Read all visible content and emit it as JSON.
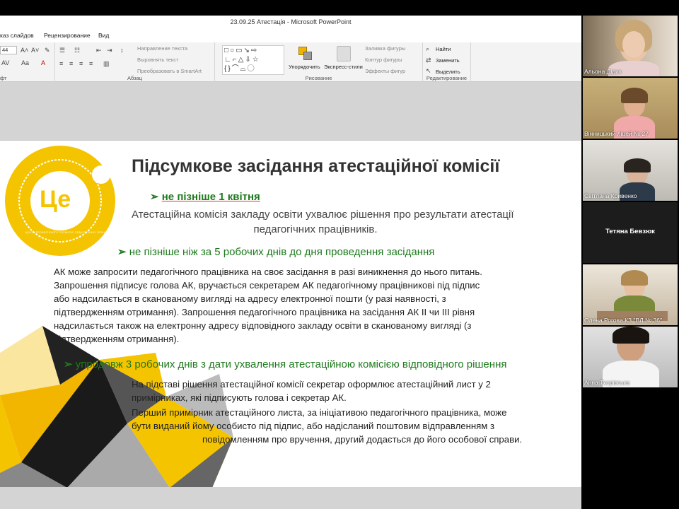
{
  "window": {
    "title": "23.09.25 Атестація  -  Microsoft PowerPoint"
  },
  "ribbon": {
    "tabs": [
      "каз слайдов",
      "Рецензирование",
      "Вид"
    ],
    "font_size": "44",
    "font_size_label_partial": "фт",
    "paragraph_group": "Абзац",
    "text_direction": "Направление текста",
    "align_text": "Выровнять текст",
    "smartart": "Преобразовать в SmartArt",
    "drawing_group": "Рисование",
    "arrange": "Упорядочить",
    "quick_styles": "Экспресс-стили",
    "shape_fill": "Заливка фигуры",
    "shape_outline": "Контур фигуры",
    "shape_effects": "Эффекты фигур",
    "find": "Найти",
    "replace": "Заменить",
    "select": "Выделить",
    "editing_group": "Редактирование"
  },
  "slide": {
    "logo_text": "Це",
    "logo_ring_text": "ЦЕНТР ПРОФЕСІЙНОГО РОЗВИТКУ ПЕДАГОГІЧНИХ ПРАЦІВНИКІВ ВМР",
    "title": "Підсумкове засідання атестаційної комісії",
    "bullet1": "не пізніше  1 квітня",
    "decision_line1": "Атестаційна комісія закладу освіти ухвалює рішення про результати атестації",
    "decision_line2": "педагогічних працівників.",
    "bullet2": "не пізніше  ніж за 5 робочих днів до дня проведення засідання",
    "para1": [
      "АК може запросити педагогічного працівника на своє засідання в разі виникнення до нього питань.",
      "Запрошення підписує голова АК, вручається секретарем АК педагогічному працівникові під підпис",
      "або надсилається в сканованому вигляді на адресу електронної пошти (у разі наявності, з",
      "підтвердженням отримання). Запрошення педагогічного працівника на засідання АК ІІ чи ІІІ рівня",
      "надсилається також на електронну адресу відповідного закладу освіти в сканованому вигляді (з",
      "підтвердженням отримання)."
    ],
    "bullet3": "упродовж 3 робочих днів з дати ухвалення атестаційною комісією відповідного рішення",
    "para2": [
      "На підставі рішення атестаційної  комісії секретар оформлює атестаційний лист у 2",
      "примірниках, які підписують голова і секретар АК.",
      "Перший примірник атестаційного листа, за ініціативою педагогічного працівника, може",
      "бути виданий йому особисто під підпис, або надісланий поштовим відправленням з",
      "повідомленням про вручення, другий додається до його особової справи."
    ]
  },
  "participants": [
    {
      "name": "Альона Дідик"
    },
    {
      "name": "Вінницький ліцей № 27"
    },
    {
      "name": "Світлана Кривенко"
    },
    {
      "name": "Тетяна Бевзюк"
    },
    {
      "name": "Олена Рогова КЗ \"ВЛ № 36\""
    },
    {
      "name": "Анна Тхорівська"
    }
  ],
  "colors": {
    "accent_yellow": "#f5c400",
    "title_gray": "#333333",
    "green": "#1d7a1d",
    "red": "#c0392b"
  }
}
